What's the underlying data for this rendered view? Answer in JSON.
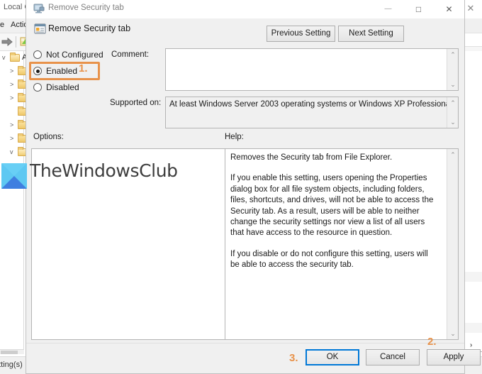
{
  "background_window": {
    "title": "Local Gr",
    "close_icon": "close-icon",
    "menus": [
      {
        "label": "e"
      },
      {
        "label": "Actio"
      }
    ],
    "toolbar": [
      {
        "icon": "forward-arrow-icon"
      },
      {
        "icon": "show-hide-tree-icon"
      }
    ],
    "tree": [
      {
        "label": "A",
        "expander": "v",
        "indent": 0
      },
      {
        "label": "",
        "expander": ">",
        "indent": 1
      },
      {
        "label": "",
        "expander": ">",
        "indent": 1
      },
      {
        "label": "",
        "expander": ">",
        "indent": 1
      },
      {
        "label": "",
        "expander": "",
        "indent": 1
      },
      {
        "label": "",
        "expander": ">",
        "indent": 1
      },
      {
        "label": "",
        "expander": ">",
        "indent": 1
      },
      {
        "label": "",
        "expander": "v",
        "indent": 1
      }
    ],
    "status_text": "etting(s)",
    "list_chevron": "›"
  },
  "dialog": {
    "titlebar": {
      "icon": "policy-monitor-icon",
      "title": "Remove Security tab",
      "minimize_glyph": "—",
      "maximize_glyph": "□",
      "close_glyph": "✕",
      "minimize_name": "minimize-button",
      "maximize_name": "maximize-button",
      "close_name": "close-button"
    },
    "header": {
      "icon": "policy-setting-icon",
      "title": "Remove Security tab"
    },
    "nav_buttons": {
      "previous": "Previous Setting",
      "next": "Next Setting"
    },
    "state_options": [
      {
        "label": "Not Configured",
        "checked": false
      },
      {
        "label": "Enabled",
        "checked": true
      },
      {
        "label": "Disabled",
        "checked": false
      }
    ],
    "comment": {
      "label": "Comment:",
      "value": "",
      "placeholder": ""
    },
    "supported_on": {
      "label": "Supported on:",
      "value": "At least Windows Server 2003 operating systems or Windows XP Professional"
    },
    "options": {
      "label": "Options:",
      "content": ""
    },
    "help": {
      "label": "Help:",
      "paragraphs": [
        "Removes the Security tab from File Explorer.",
        "If you enable this setting, users opening the Properties dialog box for all file system objects, including folders, files, shortcuts, and drives, will not be able to access the Security tab. As a result, users will be able to neither change the security settings nor view a list of all users that have access to the resource in question.",
        "If you disable or do not configure this setting, users will be able to access the security tab."
      ]
    },
    "footer_buttons": {
      "ok": "OK",
      "cancel": "Cancel",
      "apply": "Apply"
    },
    "scroll_up_glyph": "⌃",
    "scroll_down_glyph": "⌄"
  },
  "annotations": {
    "color": "#e8924a",
    "step1": "1.",
    "step2": "2.",
    "step3": "3."
  },
  "watermark": {
    "text": "TheWindowsClub",
    "logo_name": "thewindowsclub-logo"
  }
}
